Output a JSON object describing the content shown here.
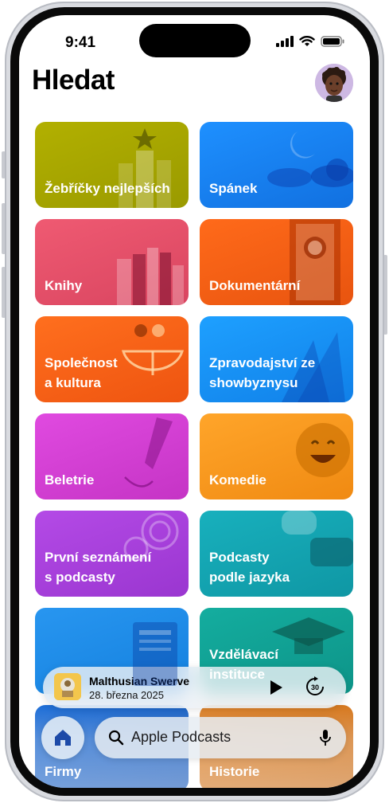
{
  "status_bar": {
    "time": "9:41"
  },
  "page": {
    "title": "Hledat"
  },
  "categories": [
    {
      "label": "Žebříčky nejlepších",
      "color": "#a6a400"
    },
    {
      "label": "Spánek",
      "color": "#1a86f0"
    },
    {
      "label": "Knihy",
      "color": "#e8506a"
    },
    {
      "label": "Dokumentární",
      "color": "#f55f1a"
    },
    {
      "label": "Společnost\na kultura",
      "color": "#f56a1a"
    },
    {
      "label": "Zpravodajství ze\nshowbyznysu",
      "color": "#1a94f0"
    },
    {
      "label": "Beletrie",
      "color": "#d63fd6"
    },
    {
      "label": "Komedie",
      "color": "#f59a1a"
    },
    {
      "label": "První seznámení\ns podcasty",
      "color": "#a843dd"
    },
    {
      "label": "Podcasty\npodle jazyka",
      "color": "#14a8b4"
    },
    {
      "label": "",
      "color": "#1e8fe8"
    },
    {
      "label": "Vzdělávací\ninstituce",
      "color": "#12a398"
    },
    {
      "label": "Firmy",
      "color": "#1d62c8"
    },
    {
      "label": "Historie",
      "color": "#d5781c"
    }
  ],
  "mini_player": {
    "title": "Malthusian Swerve",
    "date": "28. března 2025",
    "skip_label": "30"
  },
  "search": {
    "placeholder": "Apple Podcasts"
  },
  "icons": {
    "home": "house-icon",
    "search": "magnifier-icon",
    "mic": "microphone-icon",
    "play": "play-icon",
    "skip": "skip-forward-30-icon"
  }
}
